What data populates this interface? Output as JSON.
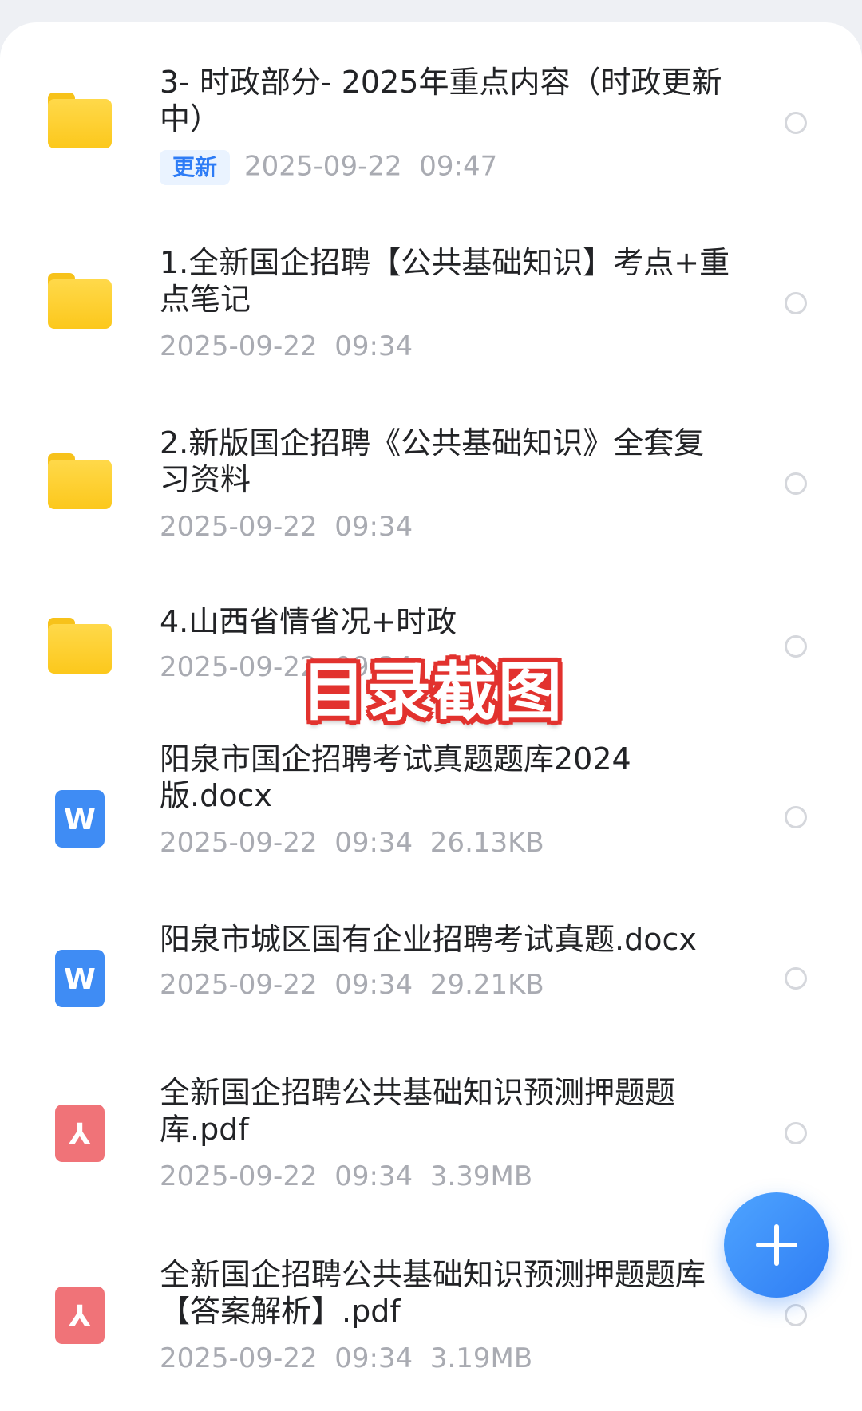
{
  "overlay_caption": "目录截图",
  "update_badge": "更新",
  "files": [
    {
      "kind": "folder",
      "icon": "folder-icon",
      "title": "3- 时政部分- 2025年重点内容（时政更新中）",
      "meta": "2025-09-22  09:47"
    },
    {
      "kind": "folder",
      "icon": "folder-icon",
      "title": "1.全新国企招聘【公共基础知识】考点+重点笔记",
      "meta": "2025-09-22  09:34"
    },
    {
      "kind": "folder",
      "icon": "folder-icon",
      "title": "2.新版国企招聘《公共基础知识》全套复习资料",
      "meta": "2025-09-22  09:34"
    },
    {
      "kind": "folder",
      "icon": "folder-icon",
      "title": "4.山西省情省况+时政",
      "meta": "2025-09-22  09:34"
    },
    {
      "kind": "word",
      "icon": "word-doc-icon",
      "title": "阳泉市国企招聘考试真题题库2024版.docx",
      "meta": "2025-09-22  09:34  26.13KB"
    },
    {
      "kind": "word",
      "icon": "word-doc-icon",
      "title": "阳泉市城区国有企业招聘考试真题.docx",
      "meta": "2025-09-22  09:34  29.21KB"
    },
    {
      "kind": "pdf",
      "icon": "pdf-icon",
      "title": "全新国企招聘公共基础知识预测押题题库.pdf",
      "meta": "2025-09-22  09:34  3.39MB"
    },
    {
      "kind": "pdf",
      "icon": "pdf-icon",
      "title": "全新国企招聘公共基础知识预测押题题库【答案解析】.pdf",
      "meta": "2025-09-22  09:34  3.19MB"
    }
  ],
  "fab": {
    "icon": "plus-icon"
  },
  "colors": {
    "accent": "#2f7df4",
    "folder": "#fcc81c",
    "word": "#3f8cf4",
    "pdf": "#f07378",
    "overlay_stroke": "#e2322e"
  }
}
